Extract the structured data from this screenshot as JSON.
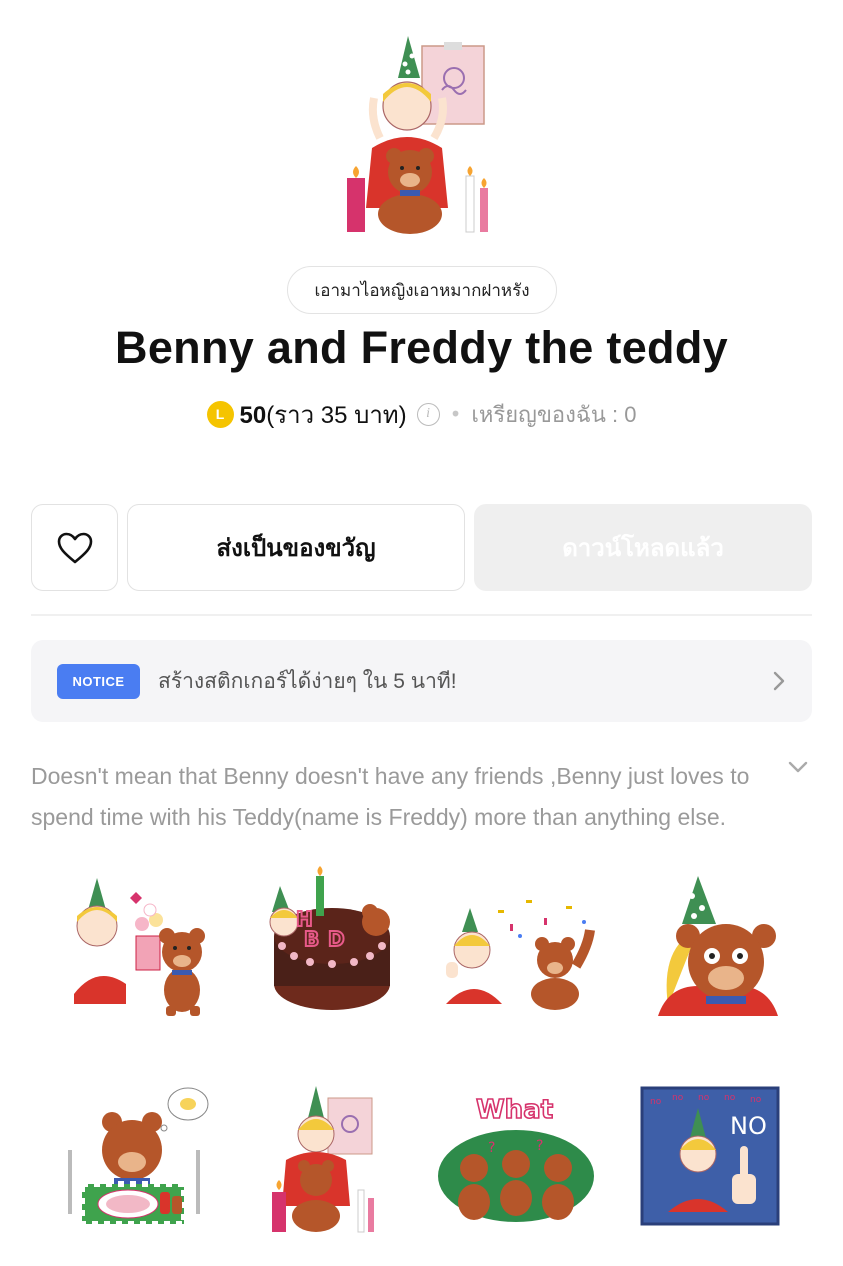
{
  "product": {
    "author": "เอามาไอหญิงเอาหมากฝาหรัง",
    "title": "Benny and Freddy the teddy",
    "coin_symbol": "L",
    "price_amount": "50",
    "price_baht": "(ราว 35 บาท)",
    "info_icon": "i",
    "separator": "•",
    "my_coins": "เหรียญของฉัน : 0"
  },
  "actions": {
    "like_icon": "heart-icon",
    "gift_label": "ส่งเป็นของขวัญ",
    "download_label": "ดาวน์โหลดแล้ว"
  },
  "notice": {
    "badge": "NOTICE",
    "text": "สร้างสติกเกอร์ได้ง่ายๆ ใน 5 นาที!",
    "arrow_icon": "chevron-right-icon"
  },
  "description": {
    "text": "Doesn't mean that Benny doesn't have any friends ,Benny just loves to spend time with his Teddy(name is Freddy) more than anything else.",
    "expand_icon": "chevron-down-icon"
  },
  "stickers": [
    {
      "name": "sticker-flowers-gift"
    },
    {
      "name": "sticker-birthday-cake",
      "text": "HBD"
    },
    {
      "name": "sticker-confetti-celebrate"
    },
    {
      "name": "sticker-teddy-closeup"
    },
    {
      "name": "sticker-teddy-hungry"
    },
    {
      "name": "sticker-drawing-candles"
    },
    {
      "name": "sticker-what-teddies",
      "text": "What"
    },
    {
      "name": "sticker-no-no",
      "text": "NO"
    }
  ],
  "colors": {
    "coin": "#f5c400",
    "notice_badge": "#4a7df2",
    "download_bg": "#efefef",
    "teddy": "#b5562a",
    "shirt": "#d9342b",
    "hair": "#f3c93c"
  }
}
